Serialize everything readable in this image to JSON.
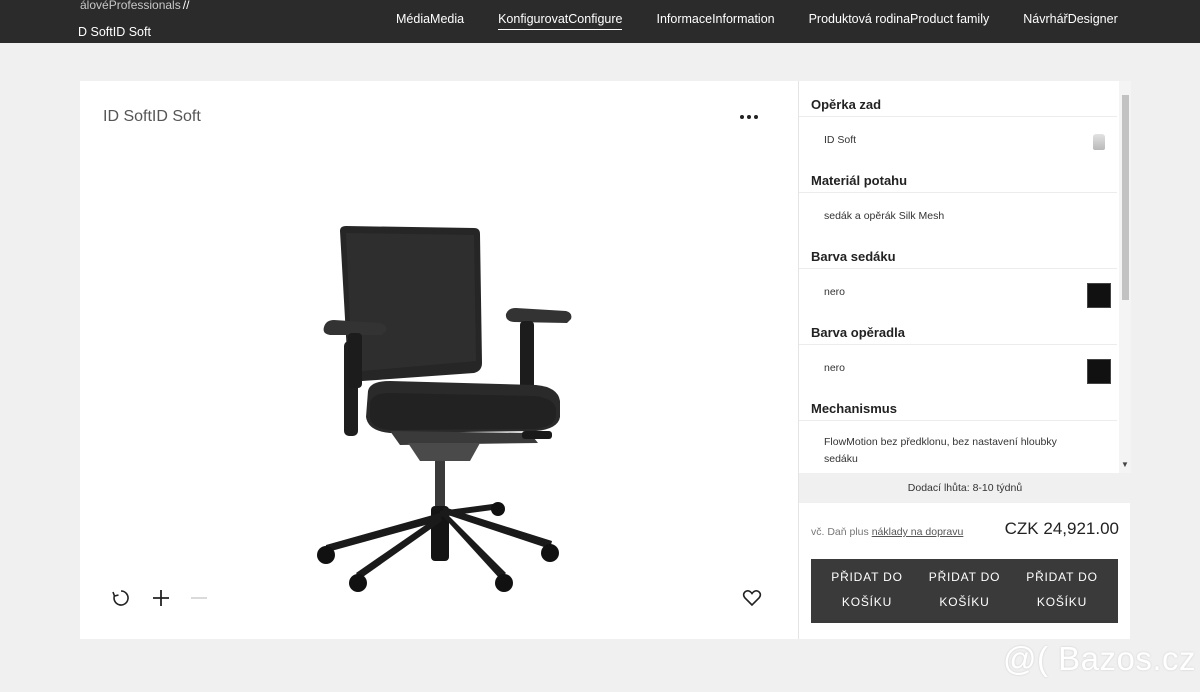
{
  "header": {
    "breadcrumb_top": "álovéProfessionals",
    "breadcrumb_sep": "//",
    "breadcrumb_title": "D SoftID Soft",
    "nav": [
      {
        "label": "MédiaMedia",
        "active": false
      },
      {
        "label": "KonfigurovatConfigure",
        "active": true
      },
      {
        "label": "InformaceInformation",
        "active": false
      },
      {
        "label": "Produktová rodinaProduct family",
        "active": false
      },
      {
        "label": "NávrhářDesigner",
        "active": false
      }
    ]
  },
  "viewer": {
    "title": "ID SoftID Soft",
    "more_icon": "more-dots-icon",
    "tools": [
      "rotate-icon",
      "plus-icon",
      "minus-icon",
      "heart-icon"
    ]
  },
  "configurator": {
    "groups": [
      {
        "heading": "Opěrka zad",
        "value": "ID Soft",
        "icon": "backrest-thumbnail-icon"
      },
      {
        "heading": "Materiál potahu",
        "value": "sedák a opěrák Silk Mesh"
      },
      {
        "heading": "Barva sedáku",
        "value": "nero",
        "swatch": "#111111"
      },
      {
        "heading": "Barva opěradla",
        "value": "nero",
        "swatch": "#111111"
      },
      {
        "heading": "Mechanismus",
        "value": "FlowMotion bez předklonu, bez nastavení hloubky sedáku"
      }
    ],
    "delivery": "Dodací lhůta: 8-10 týdnů",
    "tax_prefix": "vč. Daň plus ",
    "tax_link": "náklady na dopravu",
    "price": "CZK 24,921.00",
    "cart_labels": [
      "PŘIDAT DO KOŠÍKU",
      "PŘIDAT DO KOŠÍKU",
      "PŘIDAT DO KOŠÍKU"
    ]
  },
  "watermark": "@( Bazos.cz"
}
